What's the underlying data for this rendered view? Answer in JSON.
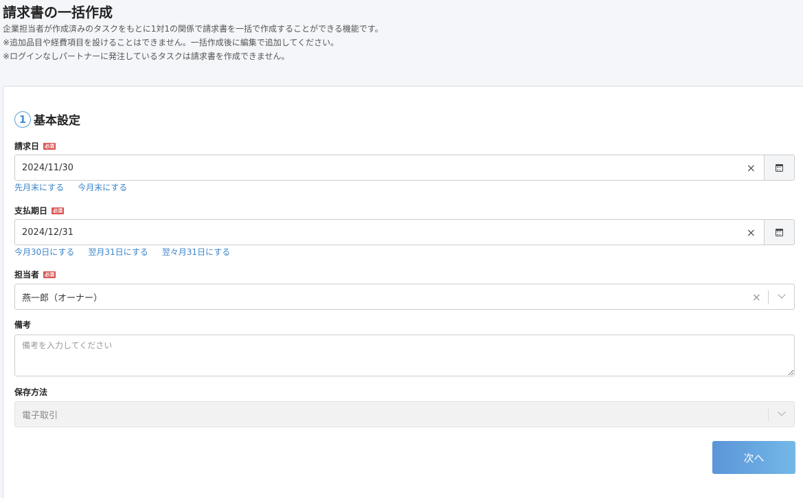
{
  "header": {
    "title": "請求書の一括作成",
    "descriptions": [
      "企業担当者が作成済みのタスクをもとに1対1の関係で請求書を一括で作成することができる機能です。",
      "※追加品目や経費項目を設けることはできません。一括作成後に編集で追加してください。",
      "※ログインなしパートナーに発注しているタスクは請求書を作成できません。"
    ]
  },
  "section": {
    "number": "1",
    "title": "基本設定"
  },
  "required_label": "必須",
  "invoice_date": {
    "label": "請求日",
    "value": "2024/11/30",
    "clear": "×",
    "shortcuts": [
      "先月末にする",
      "今月末にする"
    ]
  },
  "due_date": {
    "label": "支払期日",
    "value": "2024/12/31",
    "clear": "×",
    "shortcuts": [
      "今月30日にする",
      "翌月31日にする",
      "翌々月31日にする"
    ]
  },
  "assignee": {
    "label": "担当者",
    "value": "燕一郎（オーナー）",
    "clear": "×"
  },
  "memo": {
    "label": "備考",
    "placeholder": "備考を入力してください"
  },
  "storage": {
    "label": "保存方法",
    "value": "電子取引"
  },
  "next_button": "次へ"
}
